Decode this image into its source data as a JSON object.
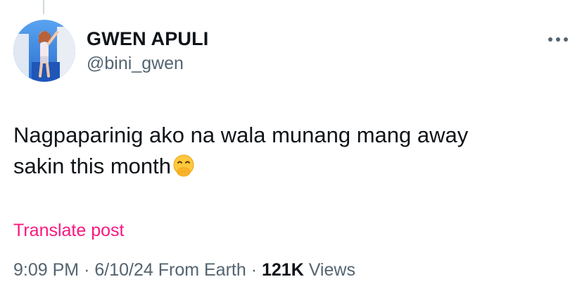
{
  "author": {
    "display_name": "GWEN APULI",
    "handle": "@bini_gwen"
  },
  "icons": {
    "avatar": "profile-photo",
    "more": "more-dots-icon",
    "emoji": "face-with-hand-over-mouth-emoji"
  },
  "tweet": {
    "text_line_1": "Nagpaparinig ako na wala munang mang away",
    "text_line_2": "sakin this month"
  },
  "translate_label": "Translate post",
  "meta": {
    "time": "9:09 PM",
    "date": "6/10/24",
    "source": "From Earth",
    "views_count": "121K",
    "views_label": "Views",
    "separator": "·"
  },
  "colors": {
    "text": "#0f1419",
    "secondary": "#536471",
    "accent": "#f91880"
  }
}
